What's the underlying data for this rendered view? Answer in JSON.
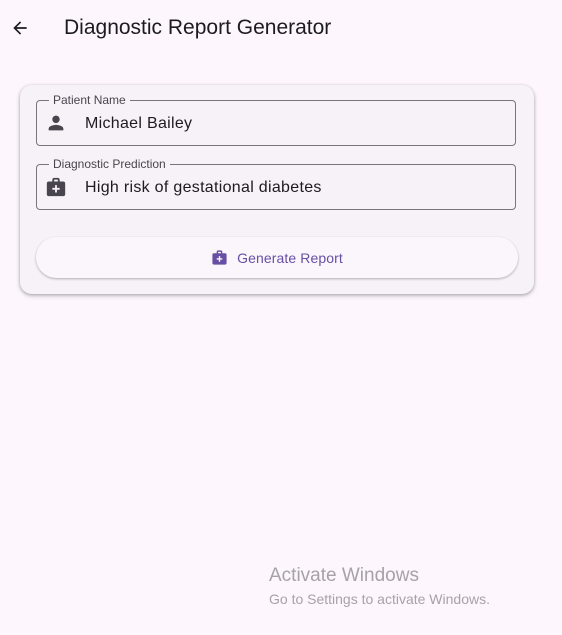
{
  "app_bar": {
    "title": "Diagnostic Report Generator",
    "back_icon": "arrow-left-icon"
  },
  "form": {
    "patient_name": {
      "label": "Patient Name",
      "value": "Michael Bailey",
      "icon": "person-icon"
    },
    "diagnostic_prediction": {
      "label": "Diagnostic Prediction",
      "value": "High risk of gestational diabetes",
      "icon": "medical-bag-icon"
    },
    "generate_button": {
      "label": "Generate Report",
      "icon": "medical-bag-icon"
    }
  },
  "watermark": {
    "title": "Activate Windows",
    "subtitle": "Go to Settings to activate Windows."
  },
  "colors": {
    "background": "#fdf7fd",
    "card": "#f7f2f7",
    "accent": "#6750a4",
    "outline": "#79747e"
  }
}
